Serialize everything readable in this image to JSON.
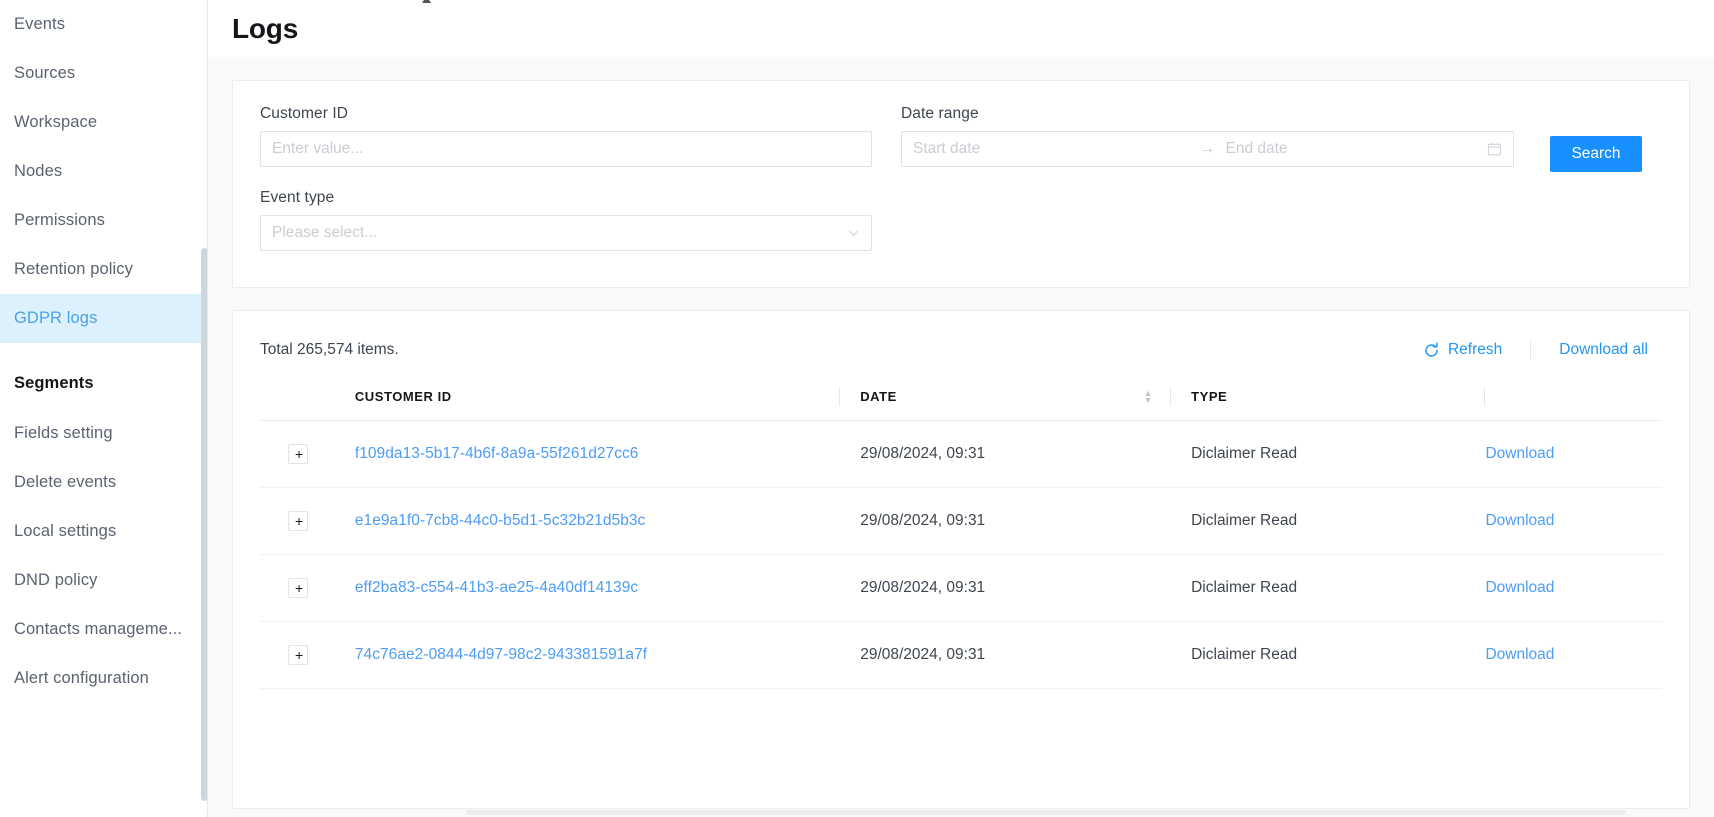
{
  "sidebar": {
    "items": [
      {
        "label": "Events",
        "type": "link",
        "active": false
      },
      {
        "label": "Sources",
        "type": "link",
        "active": false
      },
      {
        "label": "Workspace",
        "type": "link",
        "active": false
      },
      {
        "label": "Nodes",
        "type": "link",
        "active": false
      },
      {
        "label": "Permissions",
        "type": "link",
        "active": false
      },
      {
        "label": "Retention policy",
        "type": "link",
        "active": false
      },
      {
        "label": "GDPR logs",
        "type": "link",
        "active": true
      },
      {
        "label": "Segments",
        "type": "group",
        "active": false
      },
      {
        "label": "Fields setting",
        "type": "link",
        "active": false
      },
      {
        "label": "Delete events",
        "type": "link",
        "active": false
      },
      {
        "label": "Local settings",
        "type": "link",
        "active": false
      },
      {
        "label": "DND policy",
        "type": "link",
        "active": false
      },
      {
        "label": "Contacts manageme...",
        "type": "link",
        "active": false
      },
      {
        "label": "Alert configuration",
        "type": "link",
        "active": false
      }
    ]
  },
  "header": {
    "title": "Logs"
  },
  "filters": {
    "customer_id": {
      "label": "Customer ID",
      "value": "",
      "placeholder": "Enter value..."
    },
    "event_type": {
      "label": "Event type",
      "value": "",
      "placeholder": "Please select..."
    },
    "date_range": {
      "label": "Date range",
      "start_value": "",
      "start_placeholder": "Start date",
      "end_value": "",
      "end_placeholder": "End date",
      "separator": "→"
    },
    "search_button": "Search"
  },
  "table_toolbar": {
    "total_text": "Total 265,574 items.",
    "refresh_label": "Refresh",
    "download_all_label": "Download all"
  },
  "table": {
    "columns": [
      "CUSTOMER ID",
      "DATE",
      "TYPE"
    ],
    "expand_glyph": "+",
    "rows": [
      {
        "customer_id": "f109da13-5b17-4b6f-8a9a-55f261d27cc6",
        "date": "29/08/2024, 09:31",
        "type": "Diclaimer Read",
        "action": "Download"
      },
      {
        "customer_id": "e1e9a1f0-7cb8-44c0-b5d1-5c32b21d5b3c",
        "date": "29/08/2024, 09:31",
        "type": "Diclaimer Read",
        "action": "Download"
      },
      {
        "customer_id": "eff2ba83-c554-41b3-ae25-4a40df14139c",
        "date": "29/08/2024, 09:31",
        "type": "Diclaimer Read",
        "action": "Download"
      },
      {
        "customer_id": "74c76ae2-0844-4d97-98c2-943381591a7f",
        "date": "29/08/2024, 09:31",
        "type": "Diclaimer Read",
        "action": "Download"
      }
    ]
  },
  "colors": {
    "accent": "#1890ff",
    "link": "#4d9cf5",
    "active_bg": "#ddf1fc",
    "active_bar": "#2196f3",
    "text": "#3f4550",
    "heading": "#15161a",
    "placeholder": "#c9cdd2",
    "page_bg": "#fafafa",
    "border": "#ececec"
  }
}
